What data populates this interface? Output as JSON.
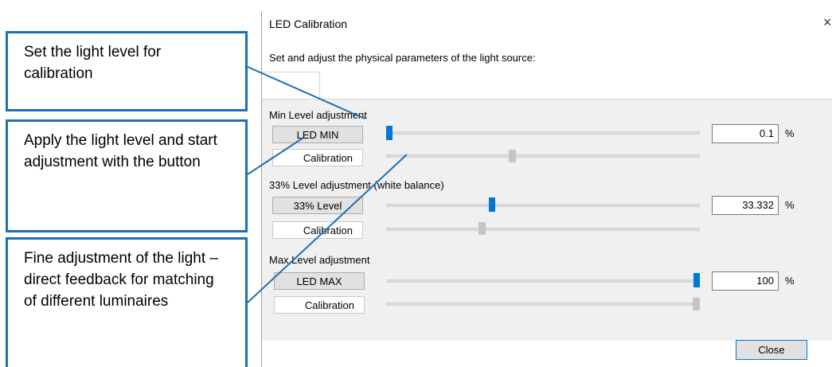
{
  "dialog": {
    "title": "LED Calibration",
    "close_glyph": "×",
    "subtitle": "Set and adjust the physical parameters of the light source:",
    "sections": [
      {
        "label": "Min Level adjustment",
        "button": "LED MIN",
        "calibration": "Calibration",
        "level_pct": 0.1,
        "calibration_pos": 0.4,
        "value": "0.1",
        "unit": "%"
      },
      {
        "label": "33% Level adjustment (white balance)",
        "button": "33% Level",
        "calibration": "Calibration",
        "level_pct": 33.332,
        "calibration_pos": 0.3,
        "value": "33.332",
        "unit": "%"
      },
      {
        "label": "Max Level adjustment",
        "button": "LED MAX",
        "calibration": "Calibration",
        "level_pct": 100,
        "calibration_pos": 1.0,
        "value": "100",
        "unit": "%"
      }
    ],
    "close_button": "Close"
  },
  "callouts": [
    {
      "text": "Set the light level for calibration"
    },
    {
      "text": "Apply the light level and start adjustment with the button"
    },
    {
      "text": "Fine adjustment of the light – direct feedback for matching of different luminaires"
    }
  ],
  "colors": {
    "accent": "#0078d7",
    "callout_border": "#1f6fb5"
  }
}
